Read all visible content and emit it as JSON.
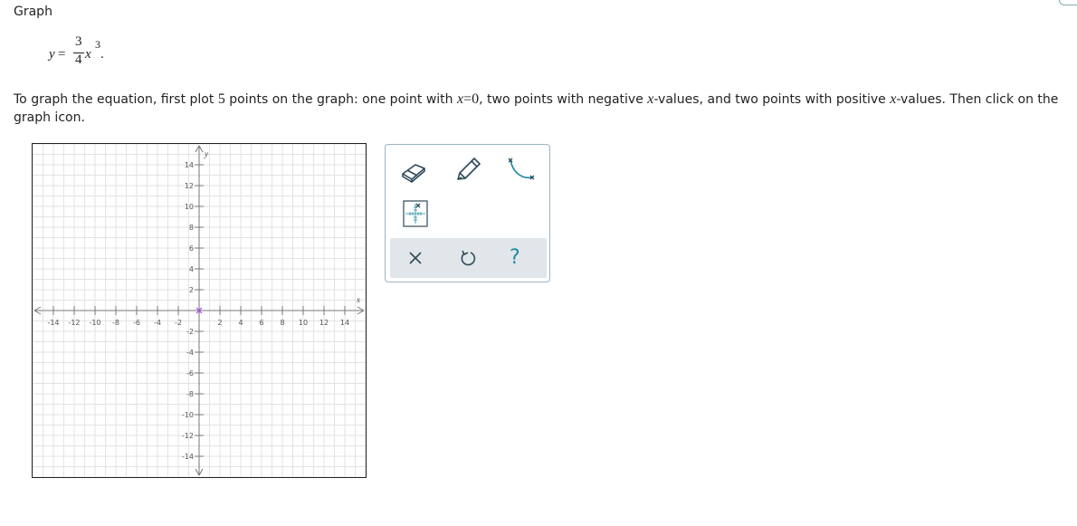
{
  "page": {
    "heading": "Graph"
  },
  "equation": {
    "lhs": "y",
    "eq": "=",
    "numerator": "3",
    "denominator": "4",
    "variable": "x",
    "exponent": "3",
    "period": "."
  },
  "instructions": {
    "p1": "To graph the equation, first plot ",
    "n_points": "5",
    "p2": " points on the graph: one point with ",
    "x1": "x",
    "eq_zero": "=0",
    "p3": ", two points with negative ",
    "x2": "x",
    "p4": "-values, and two points with positive ",
    "x3": "x",
    "p5": "-values. Then click on the graph icon."
  },
  "graph": {
    "x_axis_label": "x",
    "y_axis_label": "y",
    "x_range": [
      -16,
      16
    ],
    "y_range": [
      -16,
      16
    ],
    "grid": true,
    "x_ticks": [
      "-14",
      "-12",
      "-10",
      "-8",
      "-6",
      "-4",
      "-2",
      "2",
      "4",
      "6",
      "8",
      "10",
      "12",
      "14"
    ],
    "y_ticks": [
      "14",
      "12",
      "10",
      "8",
      "6",
      "4",
      "2",
      "-2",
      "-4",
      "-6",
      "-8",
      "-10",
      "-12",
      "-14"
    ],
    "marker_color": "#9b59d0"
  },
  "toolbox": {
    "icons": [
      "eraser-icon",
      "pencil-icon",
      "curve-tool-icon",
      "graph-icon",
      "clear-icon",
      "undo-icon",
      "help-icon"
    ],
    "help_glyph": "?",
    "clear_glyph": "×",
    "accent": "#1f8a9c"
  }
}
